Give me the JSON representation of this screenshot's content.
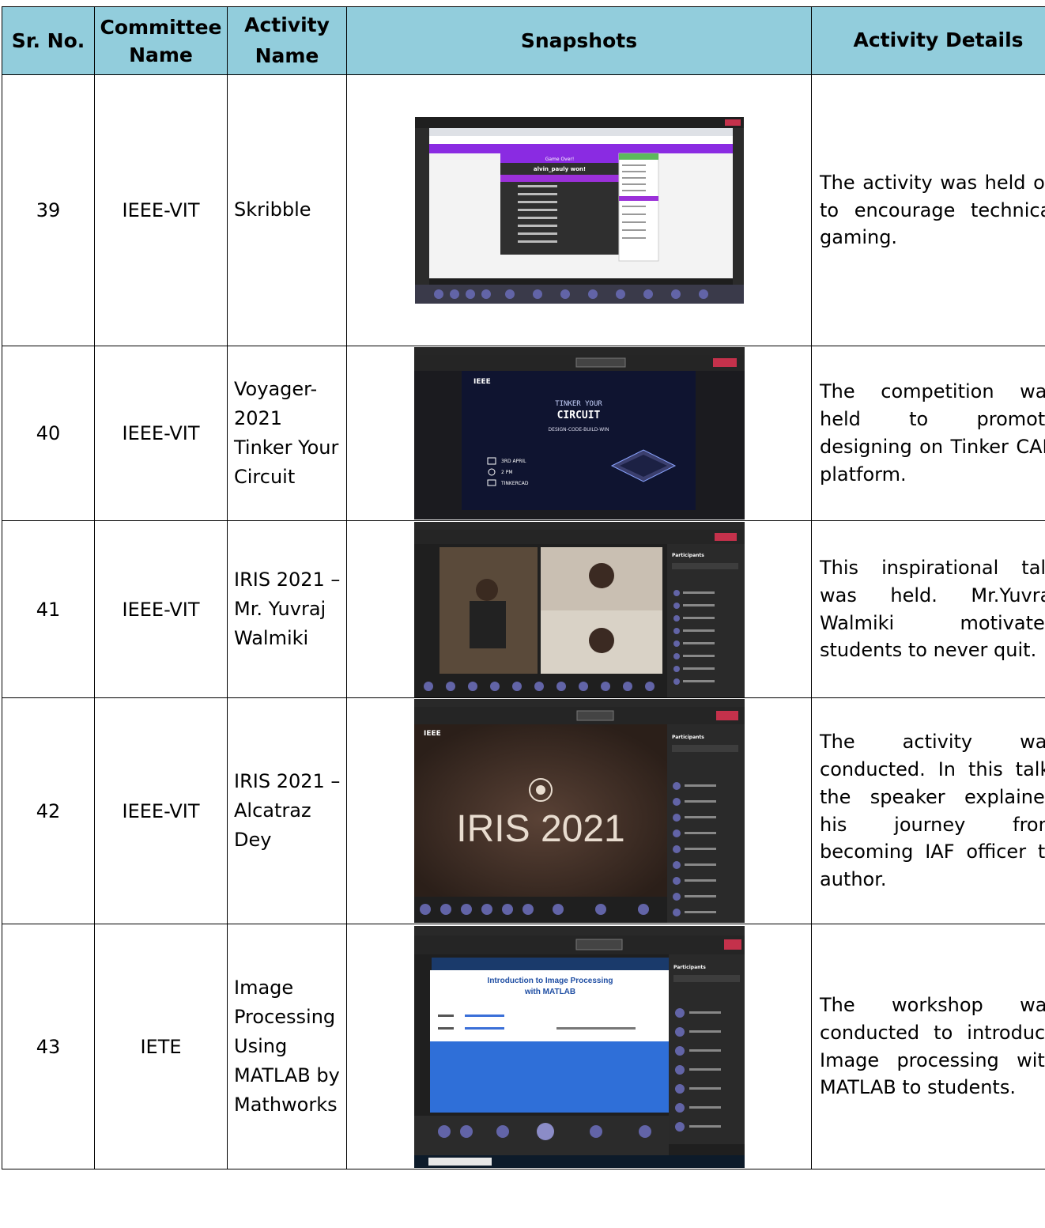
{
  "table": {
    "headers": {
      "sr_no": "Sr. No.",
      "committee": "Committee Name",
      "activity": "Activity Name",
      "snapshots": "Snapshots",
      "details": "Activity Details"
    },
    "rows": [
      {
        "sr_no": "39",
        "committee": "IEEE-VIT",
        "activity": "Skribble",
        "snapshot": {
          "title": "Game Over!",
          "winner": "alvin_pauly won!"
        },
        "details": "The activity was held on to encourage technical gaming."
      },
      {
        "sr_no": "40",
        "committee": "IEEE-VIT",
        "activity": "Voyager-2021 Tinker Your Circuit",
        "snapshot": {
          "brand": "IEEE",
          "heading_1": "TINKER YOUR",
          "heading_2": "CIRCUIT",
          "tagline": "DESIGN-CODE-BUILD-WIN",
          "date": "3RD APRIL",
          "time": "2 PM",
          "platform": "TINKERCAD"
        },
        "details": "The competition was held to promote designing on Tinker CAD platform."
      },
      {
        "sr_no": "41",
        "committee": "IEEE-VIT",
        "activity": "IRIS 2021 – Mr. Yuvraj Walmiki",
        "snapshot": {
          "panel": "Participants"
        },
        "details": "This inspirational talk was held. Mr.Yuvraj Walmiki motivated students to never quit."
      },
      {
        "sr_no": "42",
        "committee": "IEEE-VIT",
        "activity": "IRIS 2021 – Alcatraz Dey",
        "snapshot": {
          "brand": "IEEE",
          "title": "IRIS 2021",
          "panel": "Participants"
        },
        "details": "The activity was conducted. In this talk, the speaker explained his journey from becoming IAF officer to author."
      },
      {
        "sr_no": "43",
        "committee": "IETE",
        "activity": "Image Processing Using MATLAB by Mathworks",
        "snapshot": {
          "slide_title_1": "Introduction to Image Processing",
          "slide_title_2": "with MATLAB",
          "panel": "Participants"
        },
        "details": "The workshop was conducted to introduce Image processing with MATLAB to students."
      }
    ]
  }
}
